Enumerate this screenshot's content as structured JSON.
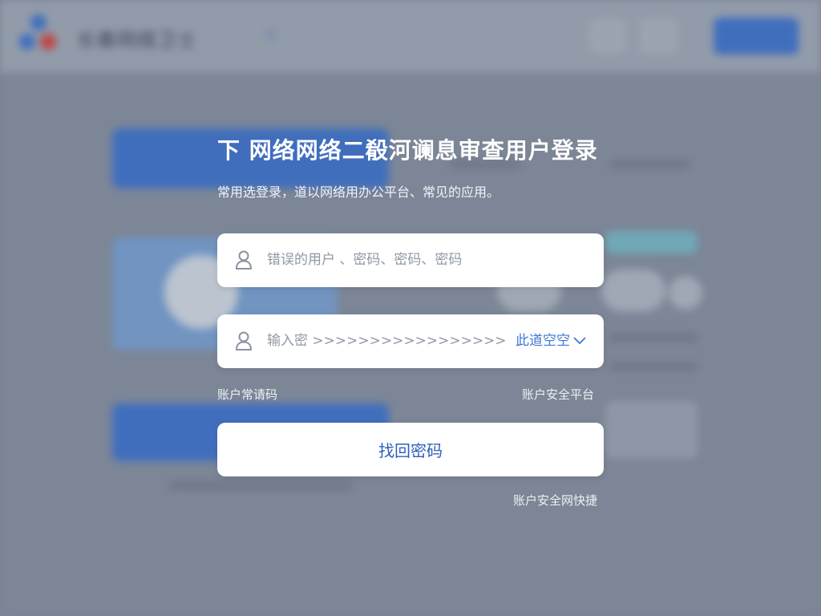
{
  "background": {
    "brand_name": "长春网络卫士",
    "logo_icon": "app-logo-icon",
    "nav_chevron_icon": "chevron-down-icon",
    "colors": {
      "accent": "#3f77d6",
      "logo_blue": "#3d78d8",
      "logo_red": "#e0443c",
      "overlay": "#8a93a3"
    }
  },
  "login": {
    "title": "下 网络网络二殽河谰息审查用户登录",
    "subtitle": "常用选登录，道以网络用办公平台、常见的应用。",
    "username": {
      "icon": "user-icon",
      "placeholder": "错误的用户 、密码、密码、密码"
    },
    "password": {
      "icon": "user-icon",
      "placeholder": "输入密 >>>>>>>>>>>>>>>>>",
      "dropdown_label": "此道空空",
      "dropdown_icon": "chevron-down-icon"
    },
    "left_link": "账户常请码",
    "right_link": "账户安全平台",
    "submit_label": "找回密码",
    "bottom_link": "账户安全网快捷"
  }
}
